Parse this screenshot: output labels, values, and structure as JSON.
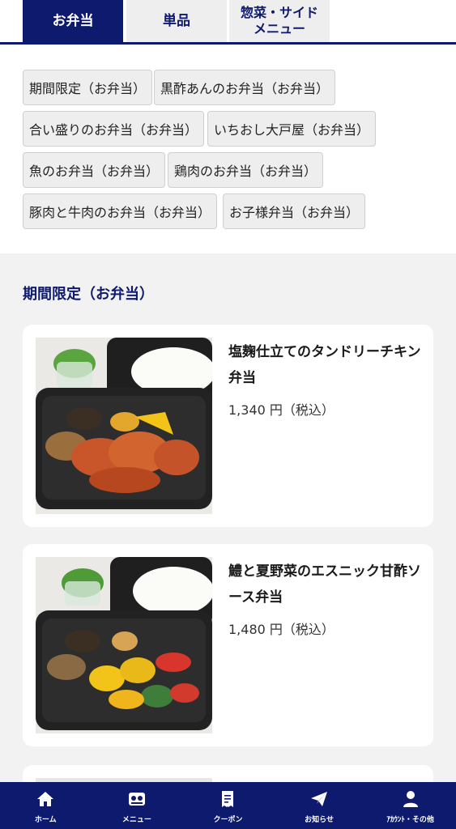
{
  "tabs": [
    {
      "label": "お弁当",
      "active": true
    },
    {
      "label": "単品",
      "active": false
    },
    {
      "label": "惣菜・サイドメニュー",
      "active": false
    }
  ],
  "categories": [
    "期間限定（お弁当）",
    "黒酢あんのお弁当（お弁当）",
    "合い盛りのお弁当（お弁当）",
    "いちおし大戸屋（お弁当）",
    "魚のお弁当（お弁当）",
    "鶏肉のお弁当（お弁当）",
    "豚肉と牛肉のお弁当（お弁当）",
    "お子様弁当（お弁当）"
  ],
  "section": {
    "title": "期間限定（お弁当）"
  },
  "products": [
    {
      "name": "塩麹仕立てのタンドリーチキン弁当",
      "price": "1,340 円（税込）"
    },
    {
      "name": "鱧と夏野菜のエスニック甘酢ソース弁当",
      "price": "1,480 円（税込）"
    }
  ],
  "bottom_nav": [
    {
      "label": "ホーム",
      "icon": "home-icon"
    },
    {
      "label": "メニュー",
      "icon": "menu-icon"
    },
    {
      "label": "クーポン",
      "icon": "coupon-icon"
    },
    {
      "label": "お知らせ",
      "icon": "paper-plane-icon"
    },
    {
      "label": "ｱｶｳﾝﾄ・その他",
      "icon": "person-icon"
    }
  ],
  "colors": {
    "brand_navy": "#0d1a6e",
    "chip_bg": "#eeeeee",
    "section_bg": "#f2f2f2"
  }
}
